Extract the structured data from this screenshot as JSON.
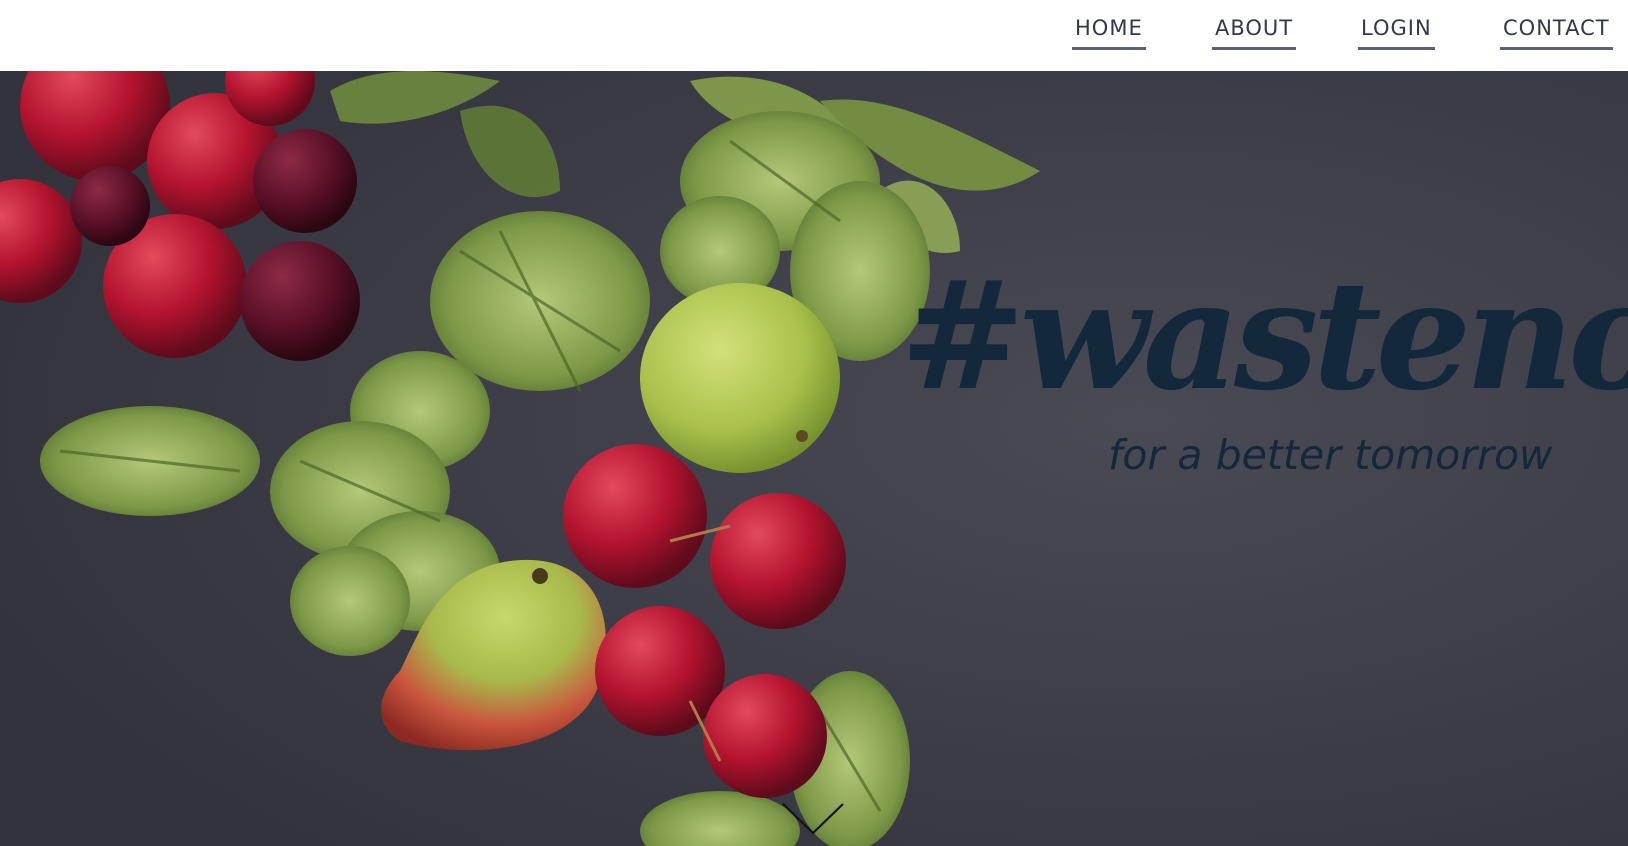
{
  "nav": {
    "items": [
      {
        "label": "HOME"
      },
      {
        "label": "ABOUT"
      },
      {
        "label": "LOGIN"
      },
      {
        "label": "CONTACT"
      }
    ]
  },
  "hero": {
    "headline": "#wastenot",
    "tagline": "for a better tomorrow",
    "background_color": "#3f3f49",
    "text_color": "#13283a",
    "scroll_icon": "chevron-down-icon"
  }
}
